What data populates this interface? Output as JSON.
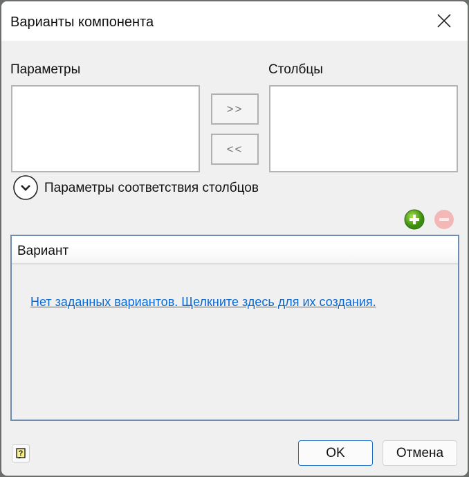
{
  "title": "Варианты компонента",
  "parameters_label": "Параметры",
  "columns_label": "Столбцы",
  "move_right_label": ">>",
  "move_left_label": "<<",
  "expander_label": "Параметры соответствия столбцов",
  "grid": {
    "header": "Вариант",
    "empty_link": "Нет заданных вариантов. Щелкните здесь для их создания."
  },
  "ok_label": "OK",
  "cancel_label": "Отмена"
}
